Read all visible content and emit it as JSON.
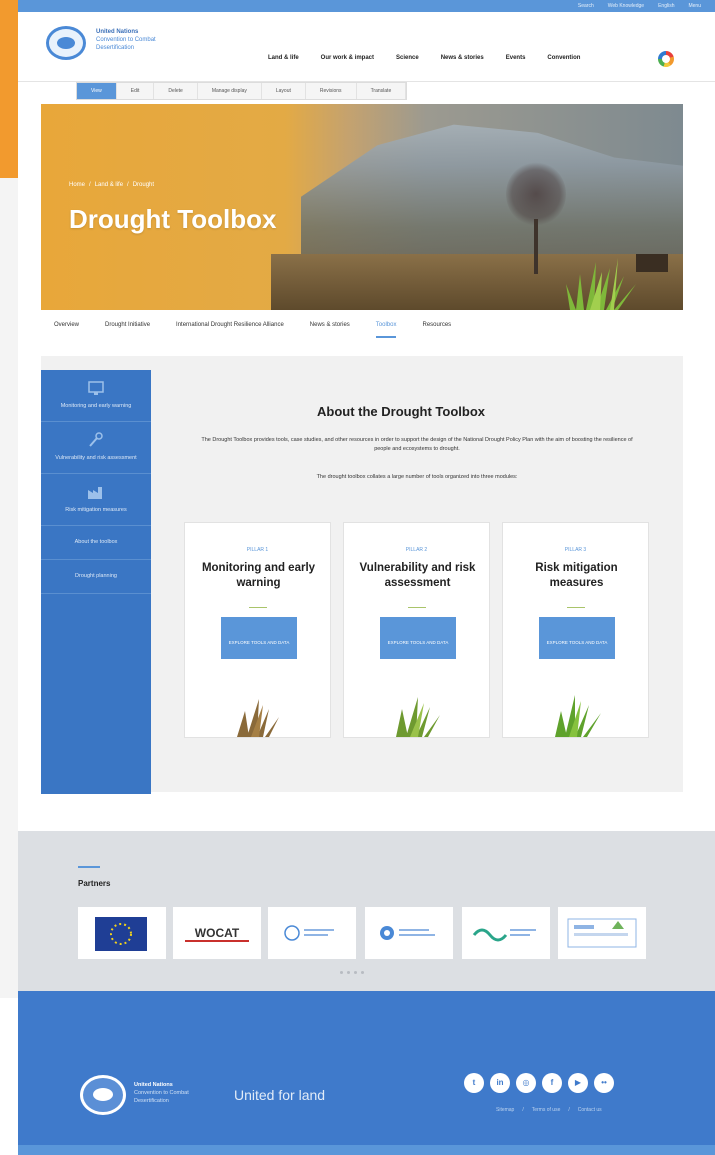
{
  "utility": {
    "links": [
      "Search",
      "Web Knowledge",
      "English",
      "Menu"
    ]
  },
  "header": {
    "logo_line1": "United Nations",
    "logo_line2": "Convention to Combat",
    "logo_line3": "Desertification",
    "nav": [
      "Land & life",
      "Our work & impact",
      "Science",
      "News & stories",
      "Events",
      "Convention"
    ]
  },
  "admin_tabs": [
    "View",
    "Edit",
    "Delete",
    "Manage display",
    "Layout",
    "Revisions",
    "Translate"
  ],
  "hero": {
    "breadcrumb": [
      "Home",
      "/",
      "Land & life",
      "/",
      "Drought"
    ],
    "title": "Drought Toolbox"
  },
  "subnav": [
    "Overview",
    "Drought Initiative",
    "International Drought Resilience Alliance",
    "News & stories",
    "Toolbox",
    "Resources"
  ],
  "sidebar": [
    {
      "label": "Monitoring and early warning",
      "icon": "monitor-icon"
    },
    {
      "label": "Vulnerability and risk assessment",
      "icon": "wrench-icon"
    },
    {
      "label": "Risk mitigation measures",
      "icon": "factory-icon"
    },
    {
      "label": "About the toolbox"
    },
    {
      "label": "Drought planning"
    }
  ],
  "about": {
    "title": "About the Drought Toolbox",
    "p1": "The Drought Toolbox provides tools, case studies, and other resources in order to support the design of the National Drought Policy Plan with the aim of boosting the resilience of people and ecosystems to drought.",
    "p2": "The drought toolbox collates a large number of tools organized into three modules:"
  },
  "cards": [
    {
      "pillar": "PILLAR 1",
      "title": "Monitoring and early warning",
      "button": "EXPLORE TOOLS AND DATA"
    },
    {
      "pillar": "PILLAR 2",
      "title": "Vulnerability and risk assessment",
      "button": "EXPLORE TOOLS AND DATA"
    },
    {
      "pillar": "PILLAR 3",
      "title": "Risk mitigation measures",
      "button": "EXPLORE TOOLS AND DATA"
    }
  ],
  "partners": {
    "title": "Partners",
    "logos": [
      {
        "name": "eu-flag-logo"
      },
      {
        "name": "wocat-logo",
        "text": "WOCAT"
      },
      {
        "name": "fao-logo"
      },
      {
        "name": "wmo-logo"
      },
      {
        "name": "partner-5-logo"
      },
      {
        "name": "partner-6-logo"
      }
    ]
  },
  "footer": {
    "logo_line1": "United Nations",
    "logo_line2": "Convention to Combat",
    "logo_line3": "Desertification",
    "tagline": "United for land",
    "socials": [
      "twitter-icon",
      "linkedin-icon",
      "instagram-icon",
      "facebook-icon",
      "youtube-icon",
      "flickr-icon"
    ],
    "links": [
      "Sitemap",
      "/",
      "Terms of use",
      "/",
      "Contact us"
    ]
  },
  "colors": {
    "brand_blue": "#3a76c4",
    "accent_blue": "#5a96d9",
    "hero_orange": "#e8a73a",
    "edge_orange": "#f29a2e"
  }
}
